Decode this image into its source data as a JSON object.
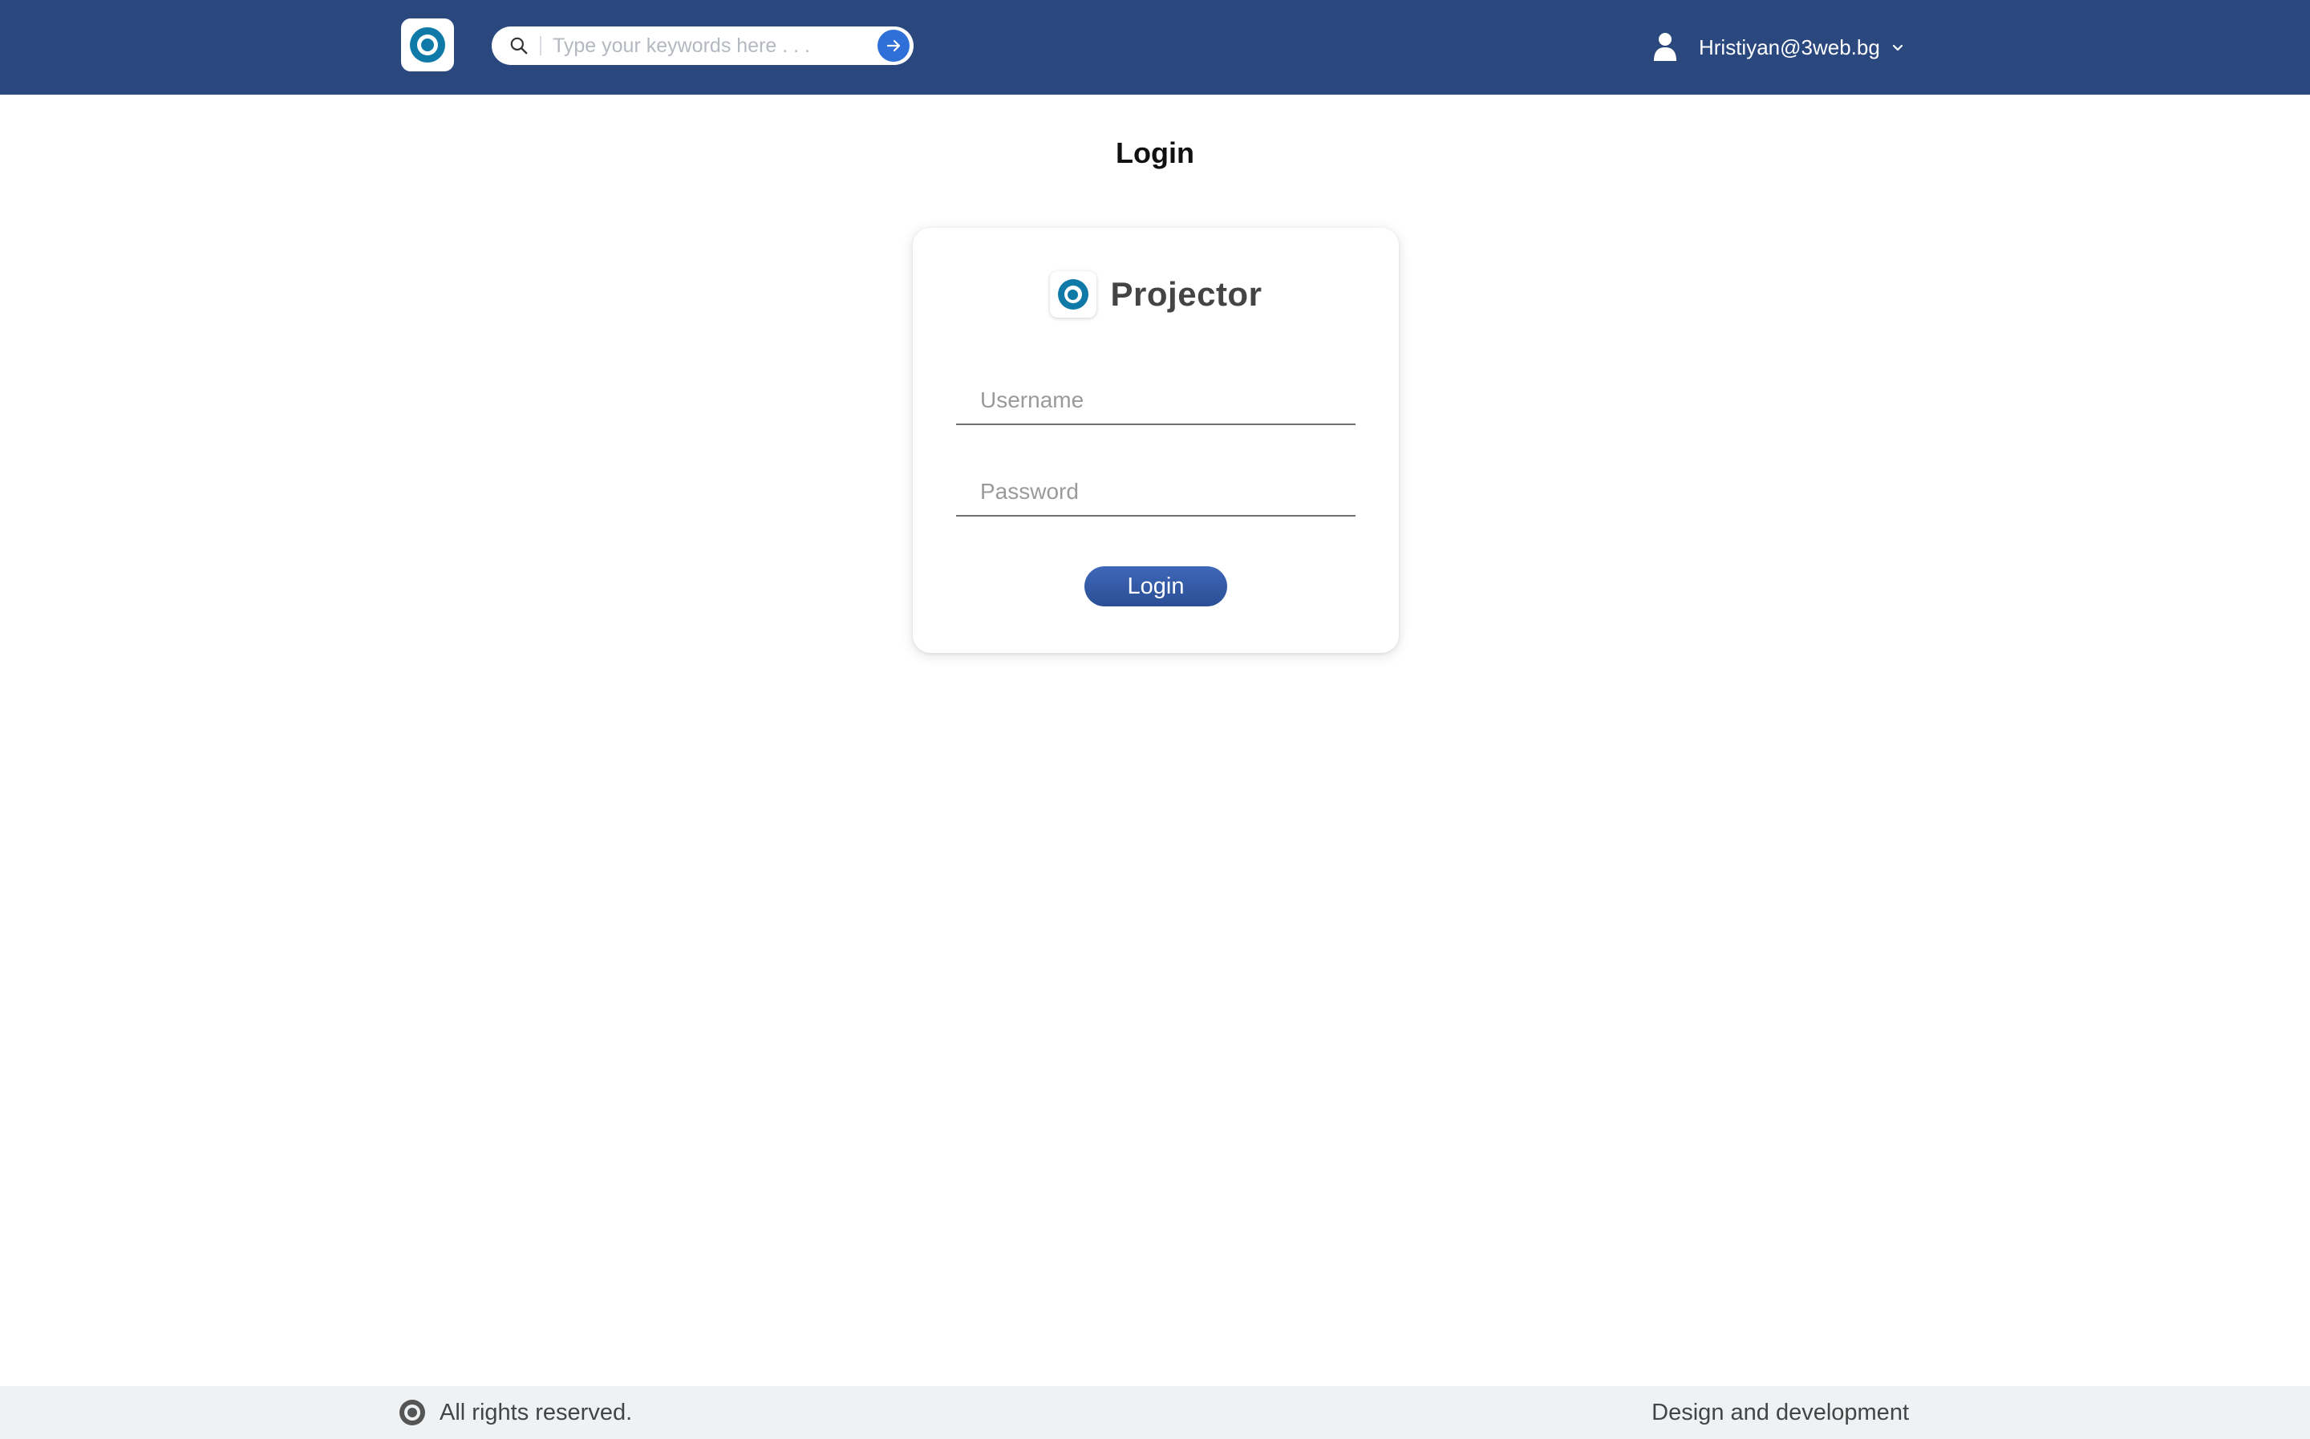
{
  "header": {
    "search": {
      "placeholder": "Type your keywords here . . .",
      "value": ""
    },
    "user": {
      "email": "Hristiyan@3web.bg"
    }
  },
  "main": {
    "title": "Login",
    "card": {
      "brand_name": "Projector",
      "username": {
        "placeholder": "Username",
        "value": ""
      },
      "password": {
        "placeholder": "Password",
        "value": ""
      },
      "login_label": "Login"
    }
  },
  "footer": {
    "rights": "All rights reserved.",
    "credit": "Design and development"
  },
  "colors": {
    "header_bg": "#2a487d",
    "accent": "#2f6fd8",
    "logo": "#0f7aa8",
    "footer_bg": "#eff2f5"
  },
  "icons": {
    "logo": "projector-logo-icon",
    "search": "search-icon",
    "submit": "arrow-right-icon",
    "user": "user-icon",
    "dropdown": "chevron-down-icon"
  }
}
